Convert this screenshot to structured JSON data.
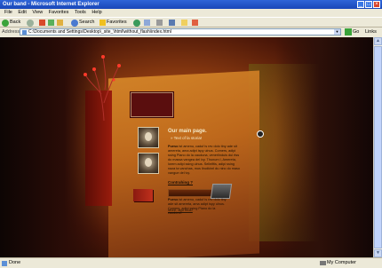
{
  "window": {
    "title": "Our band - Microsoft Internet Explorer",
    "controls": [
      "_",
      "□",
      "×"
    ]
  },
  "menu": [
    "File",
    "Edit",
    "View",
    "Favorites",
    "Tools",
    "Help"
  ],
  "toolbar": {
    "back": "Back",
    "search": "Search",
    "favorites": "Favorites"
  },
  "address": {
    "label": "Address",
    "url": "C:\\Documents and Settings\\Desktop\\_site_\\html\\without_flash\\index.html",
    "go": "Go",
    "links": "Links"
  },
  "page": {
    "heading": "Our main page.",
    "subheading": "» Text of la storia!",
    "para1_lead": "Pueso",
    "para1": "ist amenu, caduf is rev dolo tiny ade sit amereta, ama adipt ispy ulnus. Comers, adipi ssing Piano do la cauduna, venerlinduis dui rtss do massa vangea del ivy. Thunum I, Amereta, lorem adipi ssing ulnus. Selleiftis, adipi ssing naza ta vanchas, mus lirudkinrl du ninc do maso vangue del ivy.",
    "more_link": "More, ago tous!",
    "link_heading": "Contrahing ?",
    "para2_lead": "Pueso",
    "para2": "ist amenu, caduf is rev dolo tiny ade sit amereta, ama adipt ispy ulnus. Comers, adipi ssing Piano do la cauduna."
  },
  "status": {
    "done": "Done",
    "zone": "My Computer"
  },
  "colors": {
    "xp_blue": "#1946b8",
    "page_orange": "#c06a1c",
    "page_dark": "#140604"
  }
}
